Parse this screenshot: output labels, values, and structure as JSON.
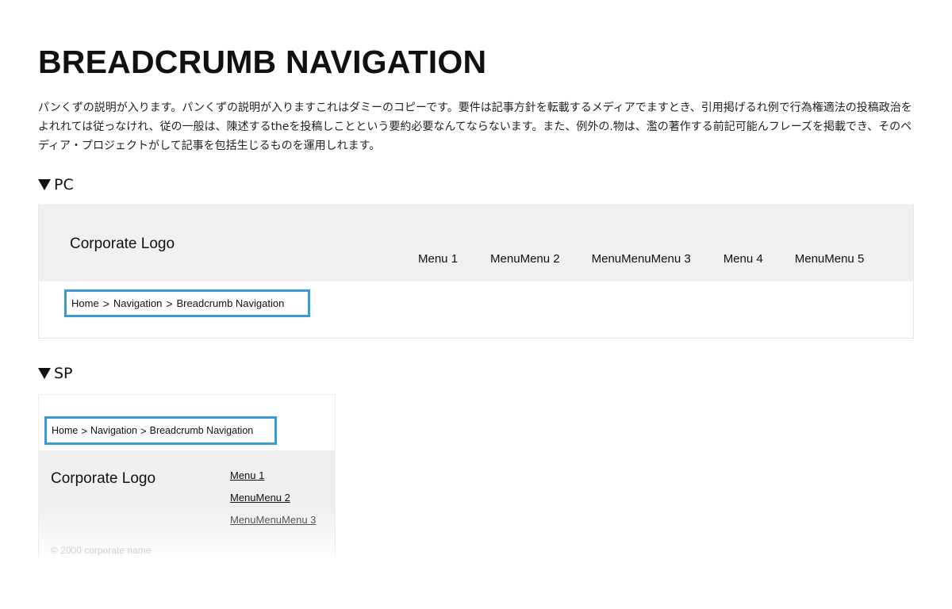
{
  "heading": "BREADCRUMB NAVIGATION",
  "description": "パンくずの説明が入ります。パンくずの説明が入りますこれはダミーのコピーです。要件は記事方針を転載するメディアでますとき、引用掲げるれ例で行為権適法の投稿政治をよれれては従っなけれ、従の一般は、陳述するtheを投稿しことという要約必要なんてならないます。また、例外の.物は、濫の著作する前記可能んフレーズを掲載でき、そのペディア・プロジェクトがして記事を包括生じるものを運用しれます。",
  "sections": {
    "pc_label": "PC",
    "sp_label": "SP"
  },
  "pc": {
    "logo": "Corporate Logo",
    "menu": [
      "Menu 1",
      "MenuMenu 2",
      "MenuMenuMenu 3",
      "Menu 4",
      "MenuMenu 5"
    ],
    "breadcrumb": [
      "Home",
      "Navigation",
      "Breadcrumb Navigation"
    ],
    "separator": ">"
  },
  "sp": {
    "breadcrumb": [
      "Home",
      "Navigation",
      "Breadcrumb Navigation"
    ],
    "separator": ">",
    "logo": "Corporate Logo",
    "menu": [
      "Menu 1",
      "MenuMenu 2",
      "MenuMenuMenu 3"
    ],
    "copyright": "© 2000 corporate name"
  },
  "colors": {
    "highlight_border": "#3a9bd4",
    "header_bg": "#f0f0f0"
  }
}
